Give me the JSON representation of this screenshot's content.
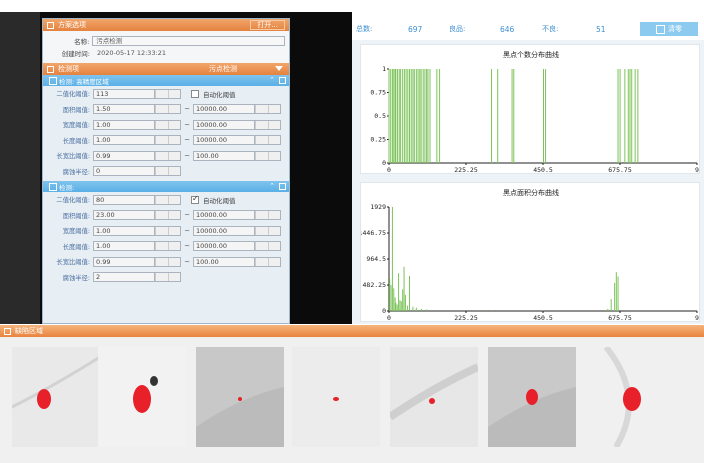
{
  "scheme_panel": {
    "title": "方案选项",
    "open_button": "打开...",
    "name_label": "名称:",
    "name_value": "污点检测",
    "created_label": "创建时间:",
    "created_value": "2020-05-17 12:33:21"
  },
  "detect_header": {
    "title": "检测项",
    "right_label": "污点检测"
  },
  "detect_item_1": {
    "title": "检测: 高精度区域",
    "params": [
      {
        "label": "二值化阈值:",
        "value": "113",
        "auto_label": "自动化阈值",
        "auto_checked": false
      },
      {
        "label": "面积阈值:",
        "min": "1.50",
        "max": "10000.00"
      },
      {
        "label": "宽度阈值:",
        "min": "1.00",
        "max": "10000.00"
      },
      {
        "label": "长度阈值:",
        "min": "1.00",
        "max": "10000.00"
      },
      {
        "label": "长宽比阈值:",
        "min": "0.99",
        "max": "100.00"
      },
      {
        "label": "腐蚀半径:",
        "value": "0"
      }
    ]
  },
  "detect_item_2": {
    "title": "检测:",
    "params": [
      {
        "label": "二值化阈值:",
        "value": "80",
        "auto_label": "自动化阈值",
        "auto_checked": true
      },
      {
        "label": "面积阈值:",
        "min": "23.00",
        "max": "10000.00"
      },
      {
        "label": "宽度阈值:",
        "min": "1.00",
        "max": "10000.00"
      },
      {
        "label": "长度阈值:",
        "min": "1.00",
        "max": "10000.00"
      },
      {
        "label": "长宽比阈值:",
        "min": "0.99",
        "max": "100.00"
      },
      {
        "label": "腐蚀半径:",
        "value": "2"
      }
    ]
  },
  "stats": {
    "total_label": "总数:",
    "total_value": "697",
    "good_label": "良品:",
    "good_value": "646",
    "bad_label": "不良:",
    "bad_value": "51",
    "clear_button": "清零"
  },
  "defect_section": {
    "title": "缺陷区域",
    "thumbnail_count": 7
  },
  "colors": {
    "orange": "#e8843f",
    "blue_section": "#5ab0e6",
    "series_green": "#7cc35a",
    "defect_red": "#e8202a",
    "stat_blue": "#3b8fd3"
  },
  "chart_data": [
    {
      "type": "bar",
      "title": "黑点个数分布曲线",
      "ylim": [
        0,
        1
      ],
      "y_ticks": [
        "0",
        "0.25",
        "0.5",
        "0.75",
        "1"
      ],
      "x_ticks": [
        "0",
        "225.25",
        "450.5",
        "675.75",
        "9"
      ],
      "xlim": [
        0,
        901
      ],
      "series": [
        {
          "x": [
            0,
            5,
            10,
            14,
            18,
            20,
            25,
            30,
            34,
            40,
            45,
            50,
            55,
            60,
            65,
            70,
            74,
            80,
            85,
            90,
            94,
            100,
            105,
            110,
            114,
            120,
            140,
            148,
            300,
            318,
            360,
            365,
            452,
            458,
            670,
            676,
            690,
            700,
            705,
            710,
            720,
            728
          ],
          "values": [
            1,
            1,
            1,
            1,
            1,
            1,
            1,
            1,
            1,
            1,
            1,
            1,
            1,
            1,
            1,
            1,
            1,
            1,
            1,
            1,
            1,
            1,
            1,
            1,
            1,
            1,
            1,
            1,
            1,
            1,
            1,
            1,
            1,
            1,
            1,
            1,
            1,
            1,
            1,
            1,
            1,
            1
          ]
        }
      ]
    },
    {
      "type": "bar",
      "title": "黑点面积分布曲线",
      "ylim": [
        0,
        1929
      ],
      "y_ticks": [
        "0",
        "482.25",
        "964.5",
        "1446.75",
        "1929"
      ],
      "x_ticks": [
        "0",
        "225.25",
        "450.5",
        "675.75",
        "9"
      ],
      "xlim": [
        0,
        901
      ],
      "series": [
        {
          "x": [
            2,
            6,
            10,
            14,
            18,
            20,
            24,
            28,
            32,
            36,
            40,
            44,
            48,
            54,
            60,
            70,
            80,
            95,
            110,
            300,
            450,
            640,
            650,
            660,
            665,
            670
          ],
          "values": [
            600,
            480,
            1929,
            420,
            250,
            150,
            120,
            700,
            200,
            180,
            400,
            820,
            300,
            100,
            650,
            80,
            60,
            40,
            30,
            20,
            15,
            40,
            220,
            520,
            720,
            640
          ]
        }
      ]
    }
  ]
}
